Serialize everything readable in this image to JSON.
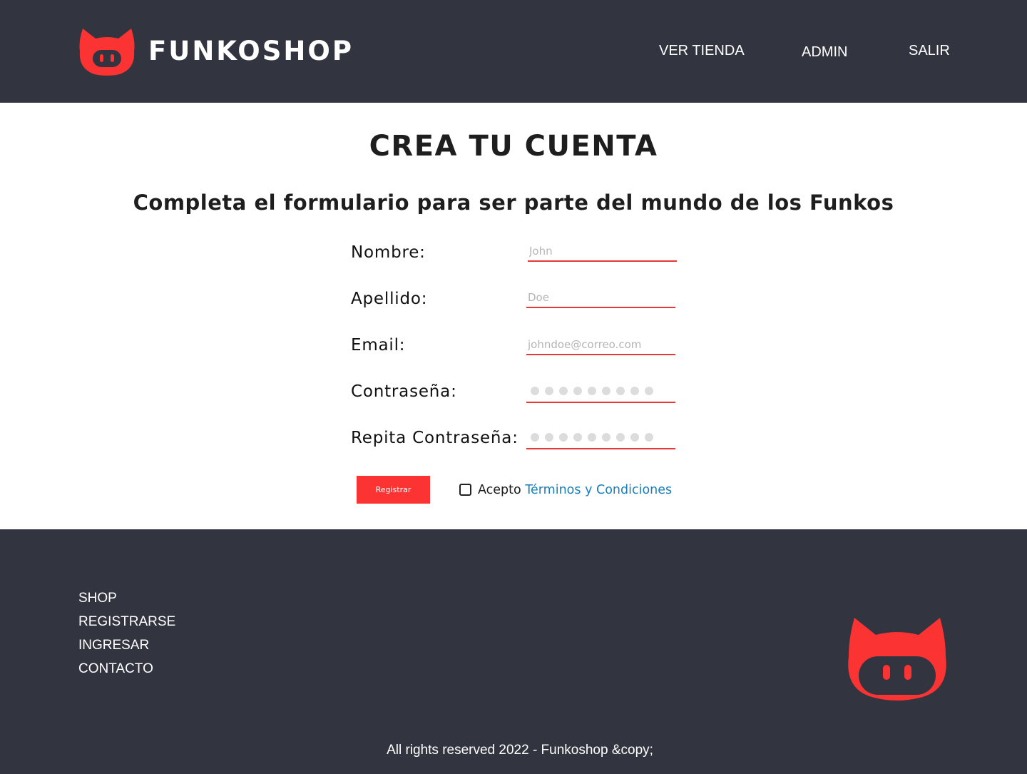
{
  "header": {
    "brand": "FUNKOSHOP",
    "logo_icon": "cat-face-logo-icon",
    "nav": [
      "VER TIENDA",
      "ADMIN",
      "SALIR"
    ]
  },
  "main": {
    "title": "CREA TU CUENTA",
    "subtitle": "Completa el formulario para ser parte del mundo de los Funkos",
    "fields": [
      {
        "label": "Nombre:",
        "placeholder": "John",
        "type": "text"
      },
      {
        "label": "Apellido:",
        "placeholder": "Doe",
        "type": "text"
      },
      {
        "label": "Email:",
        "placeholder": "johndoe@correo.com",
        "type": "email"
      },
      {
        "label": "Contraseña:",
        "placeholder": "",
        "type": "password"
      },
      {
        "label": "Repita Contraseña:",
        "placeholder": "",
        "type": "password"
      }
    ],
    "submit_label": "Registrar",
    "terms_prefix": "Acepto",
    "terms_link": "Términos y Condiciones"
  },
  "footer": {
    "links": [
      "SHOP",
      "REGISTRARSE",
      "INGRESAR",
      "CONTACTO"
    ],
    "copyright": "All rights reserved 2022 - Funkoshop &copy;"
  },
  "colors": {
    "dark": "#323540",
    "accent": "#fb3333",
    "link": "#1a7eb8",
    "input_underline": "#e53935"
  }
}
